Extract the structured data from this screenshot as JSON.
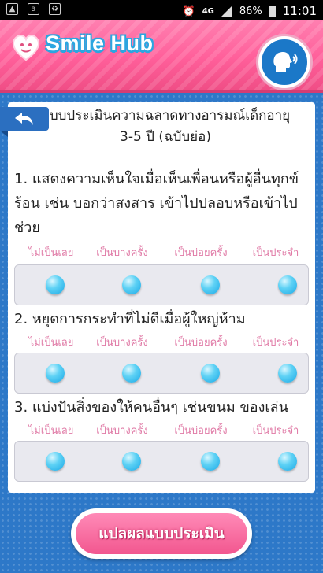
{
  "status_bar": {
    "network": "4G",
    "battery": "86%",
    "time": "11:01"
  },
  "header": {
    "app_name": "Smile Hub",
    "logo_icon": "heart-logo-icon",
    "speak_icon": "speaking-head-icon"
  },
  "card": {
    "back_icon": "back-arrow-icon",
    "title_line1": "แบบประเมินความฉลาดทางอารมณ์เด็กอายุ",
    "title_line2": "3-5 ปี (ฉบับย่อ)",
    "options": [
      "ไม่เป็นเลย",
      "เป็นบางครั้ง",
      "เป็นบ่อยครั้ง",
      "เป็นประจำ"
    ],
    "questions": [
      {
        "text": "1. แสดงความเห็นใจเมื่อเห็นเพื่อนหรือผู้อื่นทุกข์ร้อน เช่น บอกว่าสงสาร เข้าไปปลอบหรือเข้าไปช่วย"
      },
      {
        "text": "2. หยุดการกระทำที่ไม่ดีเมื่อผู้ใหญ่ห้าม"
      },
      {
        "text": "3. แบ่งปันสิ่งของให้คนอื่นๆ เช่นขนม ของเล่น"
      }
    ]
  },
  "result_button": {
    "label": "แปลผลแบบประเมิน"
  },
  "colors": {
    "header_pink": "#ff5f9a",
    "background_blue": "#2d78c8",
    "radio_blue": "#1aa8e6",
    "option_pink": "#e07aa6"
  }
}
